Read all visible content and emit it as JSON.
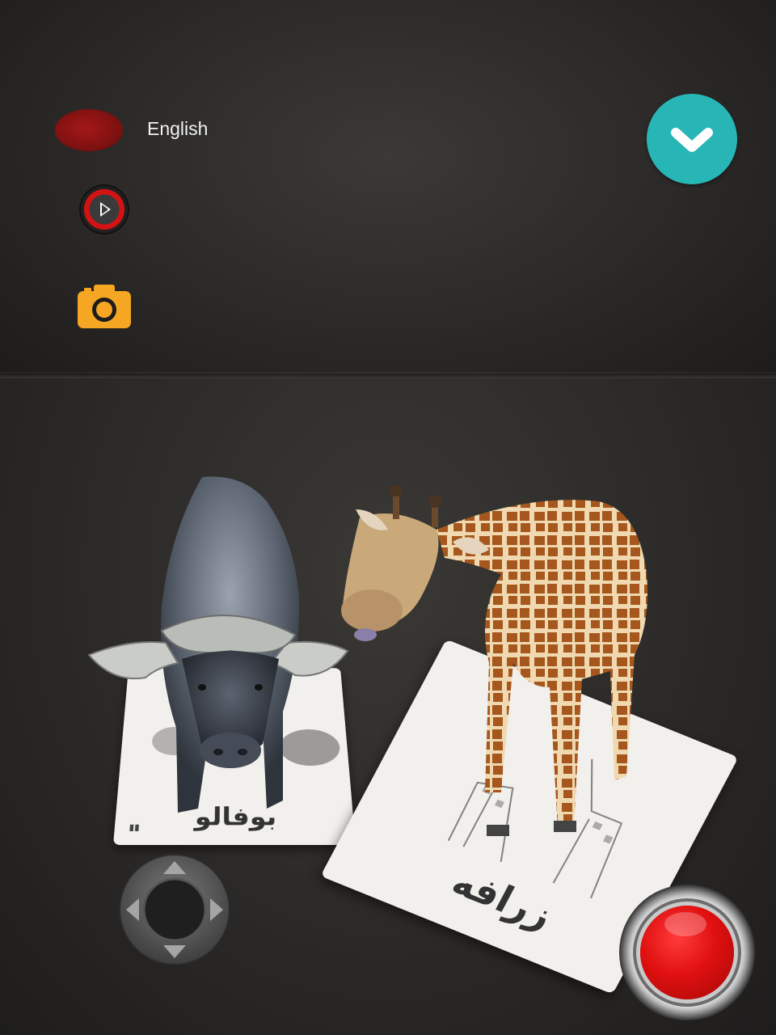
{
  "language": {
    "label": "English"
  },
  "cards": {
    "buffalo": {
      "text": "بوفالو"
    },
    "giraffe": {
      "text": "زرافه"
    }
  },
  "colors": {
    "chevron_button": "#28b5b5",
    "camera_button": "#f5a623",
    "record_button": "#e01010",
    "language_toggle": "#8e1414"
  },
  "icons": {
    "menu": "chevron-down-icon",
    "play": "play-icon",
    "camera": "camera-icon",
    "joystick": "joystick-icon",
    "record": "record-icon"
  }
}
